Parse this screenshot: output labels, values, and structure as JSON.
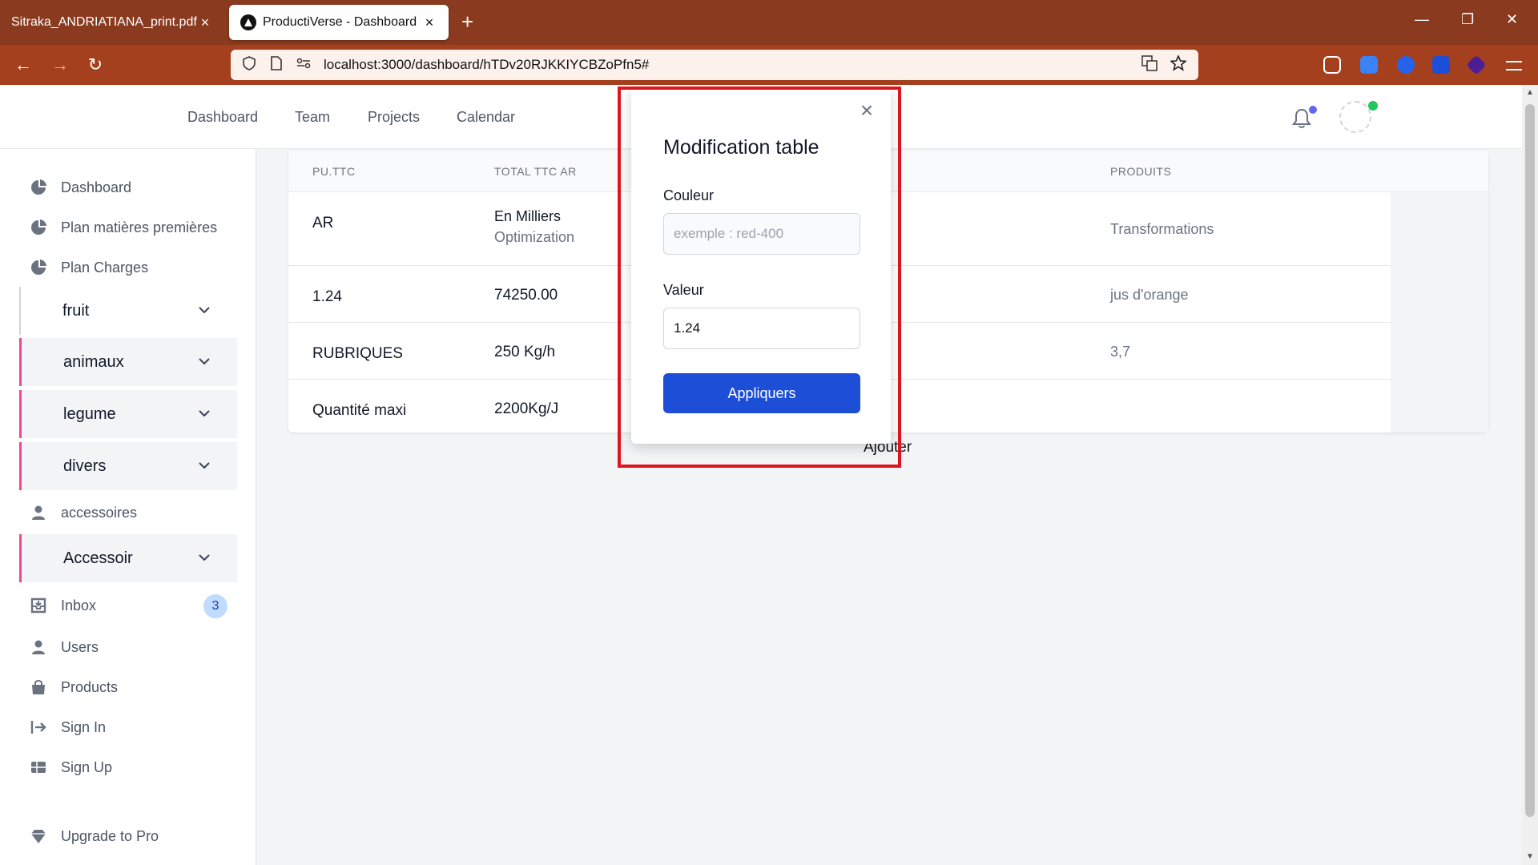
{
  "browser": {
    "tabs": [
      {
        "title": "Sitraka_ANDRIATIANA_print.pdf",
        "active": false
      },
      {
        "title": "ProductiVerse - Dashboard",
        "active": true
      }
    ],
    "close_glyph": "×",
    "new_tab_glyph": "+",
    "url": "localhost:3000/dashboard/hTDv20RJKKIYCBZoPfn5#",
    "window_controls": {
      "minimize": "—",
      "restore": "❐",
      "close": "✕"
    },
    "nav": {
      "back": "←",
      "forward": "→",
      "reload": "↻"
    }
  },
  "topnav": {
    "links": [
      "Dashboard",
      "Team",
      "Projects",
      "Calendar"
    ]
  },
  "sidebar": {
    "items_top": [
      {
        "label": "Dashboard",
        "icon": "pie-chart-icon"
      },
      {
        "label": "Plan matières premières",
        "icon": "pie-chart-icon"
      },
      {
        "label": "Plan Charges",
        "icon": "pie-chart-icon"
      }
    ],
    "groups": [
      "fruit",
      "animaux",
      "legume",
      "divers"
    ],
    "accessoires": "accessoires",
    "accessoir_group": "Accessoir",
    "items_bottom": [
      {
        "label": "Inbox",
        "icon": "inbox-icon"
      },
      {
        "label": "Users",
        "icon": "user-icon"
      },
      {
        "label": "Products",
        "icon": "shopping-bag-icon"
      },
      {
        "label": "Sign In",
        "icon": "sign-in-icon"
      },
      {
        "label": "Sign Up",
        "icon": "table-icon"
      }
    ],
    "inbox_badge": "3",
    "upgrade": "Upgrade to Pro"
  },
  "table": {
    "headers": [
      "PU.TTC",
      "TOTAL TTC AR",
      "PRODUITS"
    ],
    "rows": [
      {
        "c1": "AR",
        "c2a": "En Milliers",
        "c2b": "Optimization",
        "c3": "Transformations"
      },
      {
        "c1": "1.24",
        "c2a": "74250.00",
        "c3": "jus d'orange"
      },
      {
        "c1": "RUBRIQUES",
        "c2a": "250 Kg/h",
        "c3": "3,7"
      },
      {
        "c1": "Quantité maxi",
        "c2a": "2200Kg/J",
        "c3": ""
      }
    ]
  },
  "ajouter": "Ajouter",
  "modal": {
    "title": "Modification table",
    "close": "×",
    "couleur_label": "Couleur",
    "couleur_placeholder": "exemple : red-400",
    "valeur_label": "Valeur",
    "valeur_value": "1.24",
    "apply_label": "Appliquers"
  },
  "colors": {
    "tabbar": "#8a3a1f",
    "navbar": "#a5401f",
    "accent": "#1d4ed8",
    "highlight": "#e0141d",
    "group_border": "#ec4899"
  }
}
